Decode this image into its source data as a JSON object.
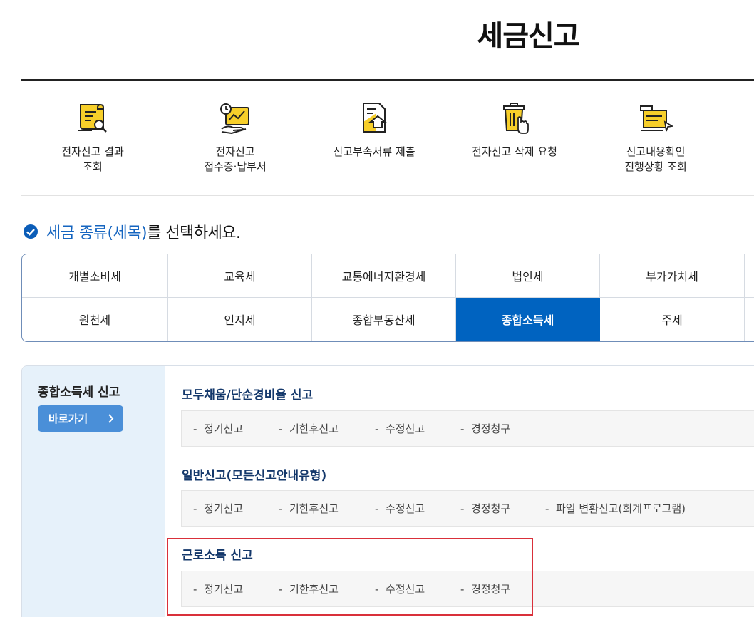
{
  "page": {
    "title": "세금신고"
  },
  "quick_menu": [
    {
      "label": "전자신고 결과\n조회",
      "icon": "document-search-icon"
    },
    {
      "label": "전자신고\n접수증·납부서",
      "icon": "receipt-clock-icon"
    },
    {
      "label": "신고부속서류 제출",
      "icon": "document-upload-icon"
    },
    {
      "label": "전자신고 삭제 요청",
      "icon": "trash-delete-icon"
    },
    {
      "label": "신고내용확인\n진행상황 조회",
      "icon": "progress-review-icon"
    }
  ],
  "section": {
    "heading_highlight": "세금 종류(세목)",
    "heading_rest": "를 선택하세요."
  },
  "tax_types": {
    "row1": [
      "개별소비세",
      "교육세",
      "교통에너지환경세",
      "법인세",
      "부가가치세"
    ],
    "row2": [
      "원천세",
      "인지세",
      "종합부동산세",
      "종합소득세",
      "주세"
    ],
    "selected": "종합소득세"
  },
  "detail": {
    "side_title": "종합소득세 신고",
    "goto_label": "바로가기",
    "groups": [
      {
        "title": "모두채움/단순경비율 신고",
        "links": [
          "정기신고",
          "기한후신고",
          "수정신고",
          "경정청구"
        ]
      },
      {
        "title": "일반신고(모든신고안내유형)",
        "links": [
          "정기신고",
          "기한후신고",
          "수정신고",
          "경정청구",
          "파일 변환신고(회계프로그램)"
        ]
      },
      {
        "title": "근로소득 신고",
        "links": [
          "정기신고",
          "기한후신고",
          "수정신고",
          "경정청구"
        ]
      }
    ]
  },
  "colors": {
    "accent": "#0063c0",
    "heading_blue": "#1565c0",
    "highlight": "#d9303a",
    "icon_yellow": "#f7cf2a"
  }
}
